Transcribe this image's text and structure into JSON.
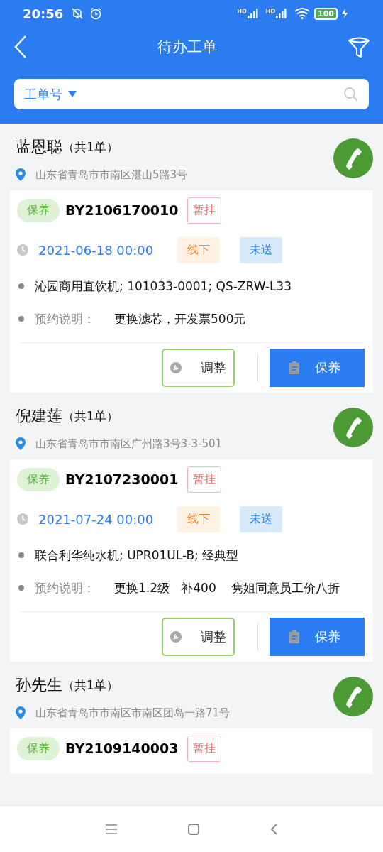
{
  "status_bar": {
    "time": "20:56",
    "signal_labels": [
      "HD",
      "HD"
    ],
    "battery": "100"
  },
  "header": {
    "title": "待办工单"
  },
  "search": {
    "field_label": "工单号"
  },
  "orders": [
    {
      "customer": "蓝恩聪",
      "count": "（共1单）",
      "address": "山东省青岛市市南区湛山5路3号",
      "type": "保养",
      "number": "BY2106170010",
      "hold": "暂挂",
      "date": "2021-06-18 00:00",
      "channel": "线下",
      "delivery": "未送",
      "product": "沁园商用直饮机; 101033-0001; QS-ZRW-L33",
      "note_label": "预约说明：",
      "note": "更换滤芯，开发票500元",
      "adjust_button": "调整",
      "action_button": "保养"
    },
    {
      "customer": "倪建莲",
      "count": "（共1单）",
      "address": "山东省青岛市市南区广州路3号3-3-501",
      "type": "保养",
      "number": "BY2107230001",
      "hold": "暂挂",
      "date": "2021-07-24 00:00",
      "channel": "线下",
      "delivery": "未送",
      "product": "联合利华纯水机; UPR01UL-B; 经典型",
      "note_label": "预约说明：",
      "note": "更换1.2级   补400    隽姐同意员工价八折",
      "adjust_button": "调整",
      "action_button": "保养"
    },
    {
      "customer": "孙先生",
      "count": "（共1单）",
      "address": "山东省青岛市市南区市南区团岛一路71号",
      "type": "保养",
      "number": "BY2109140003",
      "hold": "暂挂"
    }
  ]
}
